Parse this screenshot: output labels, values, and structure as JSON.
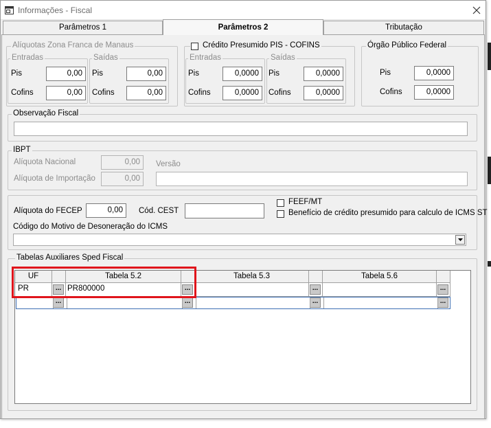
{
  "window": {
    "title": "Informações - Fiscal"
  },
  "tabs": [
    {
      "label": "Parâmetros 1",
      "active": false
    },
    {
      "label": "Parâmetros 2",
      "active": true
    },
    {
      "label": "Tributação",
      "active": false
    }
  ],
  "zona_franca": {
    "title": "Alíquotas Zona Franca de Manaus",
    "entradas": {
      "title": "Entradas",
      "pis_label": "Pis",
      "pis": "0,00",
      "cofins_label": "Cofins",
      "cofins": "0,00"
    },
    "saidas": {
      "title": "Saídas",
      "pis_label": "Pis",
      "pis": "0,00",
      "cofins_label": "Cofins",
      "cofins": "0,00"
    }
  },
  "credito_presumido": {
    "title": "Crédito Presumido PIS - COFINS",
    "checked": false,
    "entradas": {
      "title": "Entradas",
      "pis_label": "Pis",
      "pis": "0,0000",
      "cofins_label": "Cofins",
      "cofins": "0,0000"
    },
    "saidas": {
      "title": "Saídas",
      "pis_label": "Pis",
      "pis": "0,0000",
      "cofins_label": "Cofins",
      "cofins": "0,0000"
    }
  },
  "orgao_publico": {
    "title": "Órgão Público Federal",
    "pis_label": "Pis",
    "pis": "0,0000",
    "cofins_label": "Cofins",
    "cofins": "0,0000"
  },
  "observacao": {
    "title": "Observação Fiscal",
    "value": ""
  },
  "ibpt": {
    "title": "IBPT",
    "aliquota_nacional_label": "Alíquota Nacional",
    "aliquota_nacional": "0,00",
    "aliquota_importacao_label": "Alíquota de Importação",
    "aliquota_importacao": "0,00",
    "versao_label": "Versão",
    "versao": ""
  },
  "fecep": {
    "label": "Alíquota do FECEP",
    "value": "0,00"
  },
  "cest": {
    "label": "Cód. CEST",
    "value": ""
  },
  "feef": {
    "label": "FEEF/MT",
    "checked": false
  },
  "beneficio": {
    "label": "Benefício de crédito presumido para calculo de ICMS ST",
    "checked": false
  },
  "desoneracao": {
    "label": "Código do Motivo de Desoneração do ICMS",
    "value": ""
  },
  "sped": {
    "title": "Tabelas Auxiliares Sped Fiscal",
    "columns": [
      "UF",
      "Tabela 5.2",
      "Tabela 5.3",
      "Tabela 5.6"
    ],
    "button_label": "...",
    "rows": [
      {
        "uf": "PR",
        "t52": "PR800000",
        "t53": "",
        "t56": ""
      },
      {
        "uf": "",
        "t52": "",
        "t53": "",
        "t56": ""
      }
    ]
  },
  "colors": {
    "highlight": "#e0141b",
    "selection_border": "#3d6fb4"
  }
}
